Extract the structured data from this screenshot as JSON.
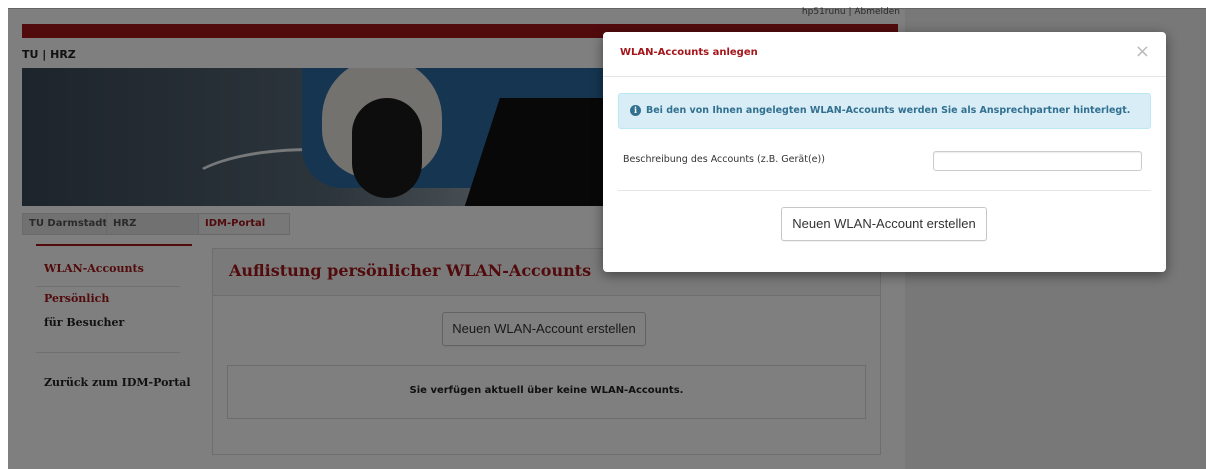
{
  "header": {
    "user_links": "hp51runu | Abmelden",
    "brand": "TU | HRZ"
  },
  "nav": {
    "tabs": [
      {
        "label": "TU Darmstadt"
      },
      {
        "label": "HRZ"
      },
      {
        "label": "IDM-Portal"
      }
    ]
  },
  "sidebar": {
    "title": "WLAN-Accounts",
    "items": [
      {
        "label": "Persönlich"
      },
      {
        "label": "für Besucher"
      }
    ],
    "back_link": "Zurück zum IDM-Portal"
  },
  "main": {
    "title": "Auflistung persönlicher WLAN-Accounts",
    "create_button": "Neuen WLAN-Account erstellen",
    "empty_message": "Sie verfügen aktuell über keine WLAN-Accounts."
  },
  "modal": {
    "title": "WLAN-Accounts anlegen",
    "close_symbol": "×",
    "info_icon": "info-icon",
    "info_text": "Bei den von Ihnen angelegten WLAN-Accounts werden Sie als Ansprechpartner hinterlegt.",
    "field_label": "Beschreibung des Accounts (z.B. Gerät(e))",
    "field_value": "",
    "submit_button": "Neuen WLAN-Account erstellen"
  },
  "colors": {
    "accent": "#a4161a",
    "info": "#31708f",
    "info_bg": "#d9edf7"
  }
}
